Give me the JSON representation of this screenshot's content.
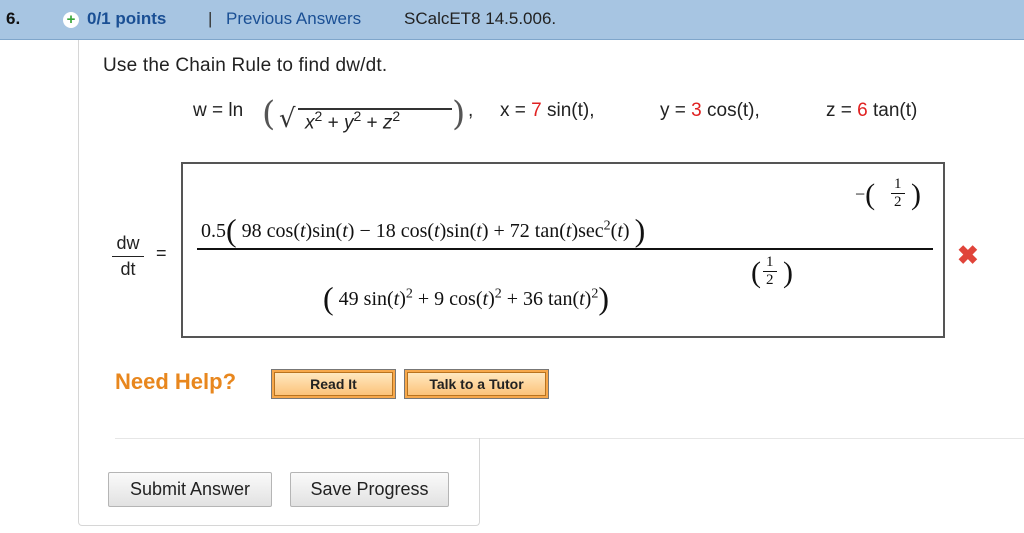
{
  "header": {
    "question_number": "6.",
    "plus_glyph": "+",
    "points": "0/1 points",
    "separator": "|",
    "previous_answers": "Previous Answers",
    "question_code": "SCalcET8 14.5.006."
  },
  "question": {
    "prompt": "Use the Chain Rule to find dw/dt.",
    "w_def": {
      "lhs": "w = ln",
      "radicand": "x² + y² + z²",
      "comma": ","
    },
    "x_def": {
      "lhs": "x = ",
      "coef": "7",
      "fn": " sin(t),"
    },
    "y_def": {
      "lhs": "y = ",
      "coef": "3",
      "fn": " cos(t),"
    },
    "z_def": {
      "lhs": "z = ",
      "coef": "6",
      "fn": " tan(t)"
    }
  },
  "answer": {
    "lhs_num": "dw",
    "lhs_den": "dt",
    "equals": "=",
    "numerator": "0.5( 98 cos(t) sin(t) − 18 cos(t) sin(t) + 72 tan(t) sec²(t) )",
    "numerator_exponent": "−(1/2)",
    "denominator": "( 49 sin(t)² + 9 cos(t)² + 36 tan(t)² )",
    "denominator_exponent": "(1/2)",
    "status_icon": "x-mark-icon",
    "status_glyph": "✖"
  },
  "help": {
    "label": "Need Help?",
    "read_it": "Read It",
    "talk_tutor": "Talk to a Tutor"
  },
  "buttons": {
    "submit": "Submit Answer",
    "save": "Save Progress"
  },
  "colors": {
    "header_bg": "#a7c5e2",
    "link_blue": "#1a4f94",
    "coef_red": "#e02020",
    "help_orange": "#e8871e",
    "error_red": "#e0443a"
  }
}
